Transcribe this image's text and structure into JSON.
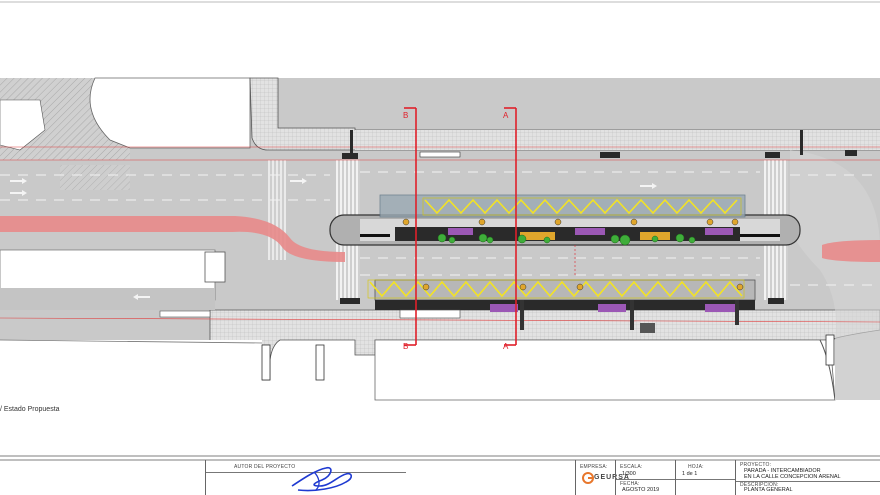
{
  "plan": {
    "section_marks": [
      "B",
      "A"
    ],
    "view_label": "/ Estado Propuesta"
  },
  "colors": {
    "asphalt": "#c9c9c9",
    "sidewalk": "#e4e4e4",
    "bus_lane": "#e88a8a",
    "section_line": "#e0202a",
    "canopy": "#f3e323",
    "platform": "#9aa9b3",
    "bench": "#9b58b5",
    "planter": "#3fae3a",
    "signature": "#1f3ad1",
    "logo_orange": "#e8772c"
  },
  "titleblock": {
    "autor_label": "AUTOR DEL PROYECTO",
    "empresa_label": "EMPRESA:",
    "company_name": "GEURSA",
    "escala_label": "ESCALA:",
    "escala_value": "1/300",
    "hoja_label": "HOJA:",
    "hoja_value": "1 de 1",
    "fecha_label": "FECHA:",
    "fecha_value": "AGOSTO 2019",
    "proyecto_label": "PROYECTO:",
    "proyecto_line1": "PARADA - INTERCAMBIADOR",
    "proyecto_line2": "EN LA CALLE CONCEPCION ARENAL",
    "descripcion_label": "DESCRIPCION:",
    "descripcion_value": "PLANTA GENERAL"
  }
}
